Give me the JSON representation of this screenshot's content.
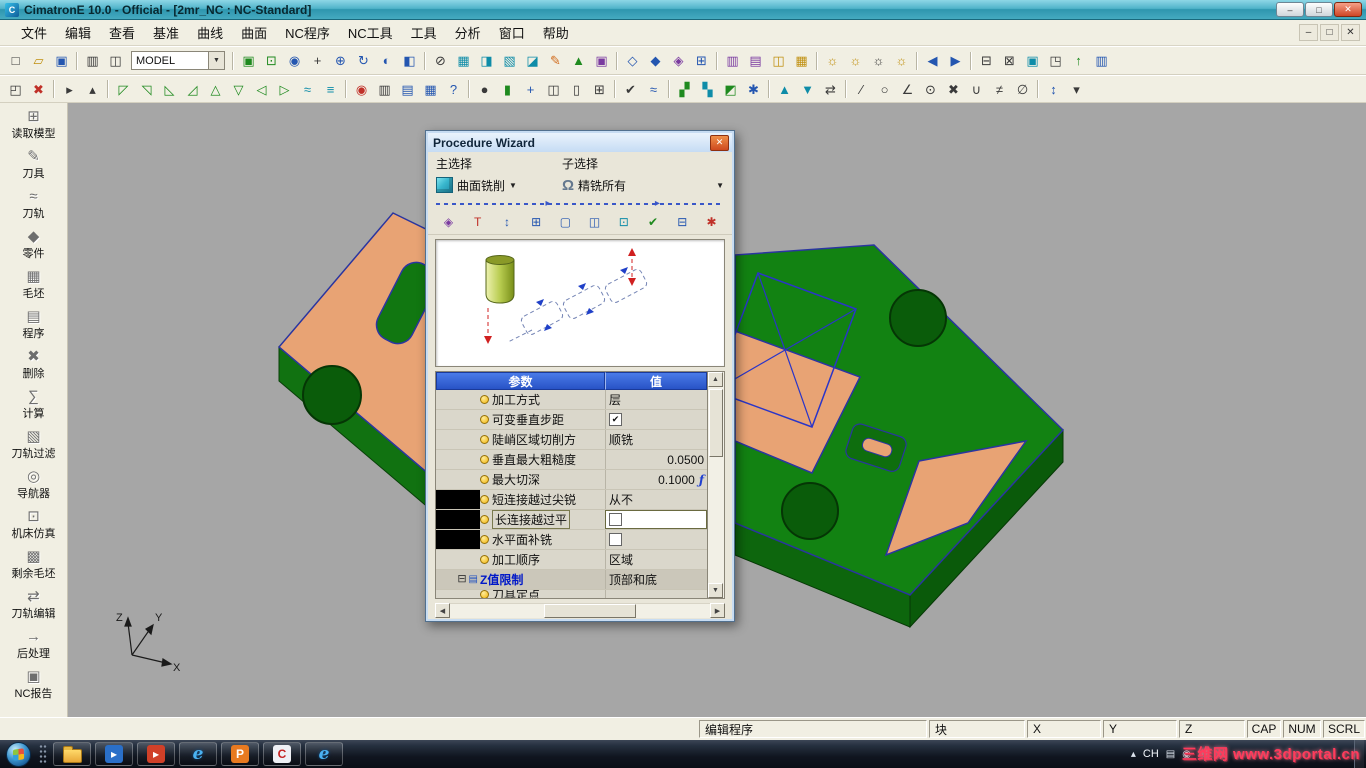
{
  "window": {
    "title": "CimatronE 10.0 - Official - [2mr_NC : NC-Standard]",
    "controls": {
      "minimize": "–",
      "restore": "□",
      "close": "✕"
    }
  },
  "menu": {
    "items": [
      "文件",
      "编辑",
      "查看",
      "基准",
      "曲线",
      "曲面",
      "NC程序",
      "NC工具",
      "工具",
      "分析",
      "窗口",
      "帮助"
    ],
    "mdi": {
      "minimize": "–",
      "restore": "□",
      "close": "✕"
    }
  },
  "toolbars": {
    "model_combo": {
      "value": "MODEL",
      "arrow": "▼"
    },
    "r1a": [
      {
        "g": "□",
        "c": "k",
        "n": "new-file-icon"
      },
      {
        "g": "▱",
        "c": "y",
        "n": "open-file-icon"
      },
      {
        "g": "▣",
        "c": "b",
        "n": "save-icon"
      },
      "|",
      {
        "g": "▥",
        "c": "k",
        "n": "print-icon"
      },
      {
        "g": "◫",
        "c": "k",
        "n": "copy-icon"
      }
    ],
    "r1b": [
      "|",
      {
        "g": "▣",
        "c": "g",
        "n": "select-box-icon"
      },
      {
        "g": "⊡",
        "c": "g",
        "n": "zoom-window-icon"
      },
      {
        "g": "◉",
        "c": "b",
        "n": "zoom-icon"
      },
      {
        "g": "+",
        "c": "k",
        "n": "pan-icon"
      },
      {
        "g": "⊕",
        "c": "b",
        "n": "zoom-all-icon"
      },
      {
        "g": "↻",
        "c": "b",
        "n": "rotate-view-icon"
      },
      {
        "g": "◐",
        "c": "b",
        "n": "shading-icon"
      },
      {
        "g": "◧",
        "c": "b",
        "n": "view-mode-icon"
      },
      "|",
      {
        "g": "⊘",
        "c": "k",
        "n": "clip-plane-icon"
      },
      {
        "g": "▦",
        "c": "c",
        "n": "wireframe-icon"
      },
      {
        "g": "◨",
        "c": "c",
        "n": "render-icon"
      },
      {
        "g": "▧",
        "c": "c",
        "n": "section-icon"
      },
      {
        "g": "◪",
        "c": "c",
        "n": "mesh-icon"
      },
      {
        "g": "✎",
        "c": "o",
        "n": "annotate-icon"
      },
      {
        "g": "▲",
        "c": "g",
        "n": "surface-icon"
      },
      {
        "g": "▣",
        "c": "p",
        "n": "solid-icon"
      },
      "|",
      {
        "g": "◇",
        "c": "b",
        "n": "point-icon"
      },
      {
        "g": "◆",
        "c": "b",
        "n": "curve-icon"
      },
      {
        "g": "◈",
        "c": "p",
        "n": "face-icon"
      },
      {
        "g": "⊞",
        "c": "b",
        "n": "grid-icon"
      },
      "|",
      {
        "g": "▥",
        "c": "p",
        "n": "program-manager-icon"
      },
      {
        "g": "▤",
        "c": "p",
        "n": "report-icon"
      },
      {
        "g": "◫",
        "c": "y",
        "n": "sheet-icon"
      },
      {
        "g": "▦",
        "c": "y",
        "n": "template-icon"
      },
      "|",
      {
        "g": "☼",
        "c": "y",
        "n": "light-icon"
      },
      {
        "g": "☼",
        "c": "y",
        "n": "light2-icon"
      },
      {
        "g": "☼",
        "c": "k",
        "n": "light-off-icon"
      },
      {
        "g": "☼",
        "c": "y",
        "n": "light3-icon"
      },
      "|",
      {
        "g": "◀",
        "c": "b",
        "n": "previous-icon"
      },
      {
        "g": "▶",
        "c": "b",
        "n": "next-icon"
      },
      "|",
      {
        "g": "⊟",
        "c": "k",
        "n": "minimize-view-icon"
      },
      {
        "g": "⊠",
        "c": "k",
        "n": "close-view-icon"
      },
      {
        "g": "▣",
        "c": "c",
        "n": "arrange-icon"
      },
      {
        "g": "◳",
        "c": "k",
        "n": "new-window-icon"
      },
      {
        "g": "↑",
        "c": "g",
        "n": "up-icon"
      },
      {
        "g": "▥",
        "c": "b",
        "n": "properties-icon"
      }
    ],
    "r2": [
      {
        "g": "◰",
        "c": "k",
        "n": "selection-filter-icon"
      },
      {
        "g": "✖",
        "c": "r",
        "n": "clear-selection-icon"
      },
      "|",
      {
        "g": "▸",
        "c": "k",
        "n": "pick-icon"
      },
      {
        "g": "▴",
        "c": "k",
        "n": "pick-chain-icon"
      },
      "|",
      {
        "g": "◸",
        "c": "g"
      },
      {
        "g": "◹",
        "c": "g"
      },
      {
        "g": "◺",
        "c": "g"
      },
      {
        "g": "◿",
        "c": "g"
      },
      {
        "g": "△",
        "c": "g"
      },
      {
        "g": "▽",
        "c": "g"
      },
      {
        "g": "◁",
        "c": "g"
      },
      {
        "g": "▷",
        "c": "g"
      },
      {
        "g": "≈",
        "c": "c"
      },
      {
        "g": "≡",
        "c": "c"
      },
      "|",
      {
        "g": "◉",
        "c": "r",
        "n": "record-icon"
      },
      {
        "g": "▥",
        "c": "k"
      },
      {
        "g": "▤",
        "c": "b"
      },
      {
        "g": "▦",
        "c": "b"
      },
      {
        "g": "?",
        "c": "b",
        "n": "help-icon"
      },
      "|",
      {
        "g": "●",
        "c": "k"
      },
      {
        "g": "▮",
        "c": "g"
      },
      {
        "g": "+",
        "c": "b"
      },
      {
        "g": "◫",
        "c": "k"
      },
      {
        "g": "▯",
        "c": "k"
      },
      {
        "g": "⊞",
        "c": "k"
      },
      "|",
      {
        "g": "✔",
        "c": "k",
        "n": "validate-icon"
      },
      {
        "g": "≈",
        "c": "b"
      },
      "|",
      {
        "g": "▞",
        "c": "g"
      },
      {
        "g": "▚",
        "c": "c"
      },
      {
        "g": "◩",
        "c": "g"
      },
      {
        "g": "✱",
        "c": "b"
      },
      "|",
      {
        "g": "▲",
        "c": "c"
      },
      {
        "g": "▼",
        "c": "c"
      },
      {
        "g": "⇄",
        "c": "k"
      },
      "|",
      {
        "g": "∕",
        "c": "k",
        "n": "line-icon"
      },
      {
        "g": "○",
        "c": "k",
        "n": "circle-icon"
      },
      {
        "g": "∠",
        "c": "k",
        "n": "angle-icon"
      },
      {
        "g": "⊙",
        "c": "k"
      },
      {
        "g": "✖",
        "c": "k"
      },
      {
        "g": "∪",
        "c": "k"
      },
      {
        "g": "≠",
        "c": "k"
      },
      {
        "g": "∅",
        "c": "k"
      },
      "|",
      {
        "g": "↕",
        "c": "b",
        "n": "measure-icon"
      },
      {
        "g": "▾",
        "c": "k"
      }
    ]
  },
  "sidebar": {
    "items": [
      {
        "label": "读取模型",
        "icon": "read-model-icon",
        "glyph": "⊞"
      },
      {
        "label": "刀具",
        "icon": "tool-icon",
        "glyph": "✎"
      },
      {
        "label": "刀轨",
        "icon": "toolpath-icon",
        "glyph": "≈"
      },
      {
        "label": "零件",
        "icon": "part-icon",
        "glyph": "◆"
      },
      {
        "label": "毛坯",
        "icon": "stock-icon",
        "glyph": "▦"
      },
      {
        "label": "程序",
        "icon": "program-icon",
        "glyph": "▤"
      },
      {
        "label": "删除",
        "icon": "delete-icon",
        "glyph": "✖"
      },
      {
        "label": "计算",
        "icon": "calculate-icon",
        "glyph": "∑"
      },
      {
        "label": "刀轨过滤",
        "icon": "toolpath-filter-icon",
        "glyph": "▧"
      },
      {
        "label": "导航器",
        "icon": "navigator-icon",
        "glyph": "◎"
      },
      {
        "label": "机床仿真",
        "icon": "machine-sim-icon",
        "glyph": "⊡"
      },
      {
        "label": "剩余毛坯",
        "icon": "remaining-stock-icon",
        "glyph": "▩"
      },
      {
        "label": "刀轨编辑",
        "icon": "toolpath-edit-icon",
        "glyph": "⇄"
      },
      {
        "label": "后处理",
        "icon": "post-process-icon",
        "glyph": "→"
      },
      {
        "label": "NC报告",
        "icon": "nc-report-icon",
        "glyph": "▣"
      }
    ]
  },
  "viewport": {
    "axes": {
      "x": "X",
      "y": "Y",
      "z": "Z"
    }
  },
  "dialog": {
    "title": "Procedure Wizard",
    "close_glyph": "✕",
    "dropdown_glyph": "▼",
    "main_label": "主选择",
    "sub_label": "子选择",
    "main_value": "曲面铣削",
    "sub_value": "精铣所有",
    "toolbar": [
      {
        "g": "◈",
        "c": "p",
        "n": "geometry-icon"
      },
      {
        "g": "T",
        "c": "r",
        "n": "tool-icon"
      },
      {
        "g": "↕",
        "c": "b",
        "n": "z-levels-icon"
      },
      {
        "g": "⊞",
        "c": "b",
        "n": "parameters-icon"
      },
      {
        "g": "▢",
        "c": "b",
        "n": "preview-icon"
      },
      {
        "g": "◫",
        "c": "b",
        "n": "display-icon"
      },
      {
        "g": "⊡",
        "c": "c",
        "n": "simulate-icon"
      },
      {
        "g": "✔",
        "c": "g",
        "n": "verify-icon"
      },
      {
        "g": "⊟",
        "c": "b",
        "n": "save-procedure-icon"
      },
      {
        "g": "✱",
        "c": "r",
        "n": "execute-icon"
      }
    ],
    "table": {
      "param_header": "参数",
      "value_header": "值",
      "check_glyph": "✔",
      "formula_glyph": "ƒ",
      "rows": [
        {
          "param": "加工方式",
          "value": "层",
          "type": "text"
        },
        {
          "param": "可变垂直步距",
          "type": "checkbox",
          "checked": true
        },
        {
          "param": "陡峭区域切削方",
          "value": "顺铣",
          "type": "text"
        },
        {
          "param": "垂直最大粗糙度",
          "value": "0.0500",
          "type": "number"
        },
        {
          "param": "最大切深",
          "value": "0.1000",
          "type": "number",
          "formula": true
        },
        {
          "param": "短连接越过尖锐",
          "value": "从不",
          "type": "text",
          "black": true
        },
        {
          "param": "长连接越过平",
          "type": "checkbox",
          "checked": false,
          "black": true,
          "selected": true
        },
        {
          "param": "水平面补铣",
          "type": "checkbox",
          "checked": false,
          "black": true
        },
        {
          "param": "加工顺序",
          "value": "区域",
          "type": "text"
        },
        {
          "param": "Z值限制",
          "value": "顶部和底",
          "type": "group"
        },
        {
          "param": "刀具定点",
          "value": "",
          "type": "text",
          "clipped": true
        }
      ]
    }
  },
  "statusbar": {
    "program": "编辑程序",
    "block": "块",
    "x_label": "X",
    "y_label": "Y",
    "z_label": "Z",
    "cap": "CAP",
    "num": "NUM",
    "scrl": "SCRL"
  },
  "taskbar": {
    "apps": [
      {
        "n": "explorer-icon",
        "folder": true
      },
      {
        "n": "media-player-icon",
        "g": "▸",
        "bg": "#2A6FC8",
        "fg": "#FFFFFF"
      },
      {
        "n": "video-app-icon",
        "g": "▸",
        "bg": "#D04028",
        "fg": "#FFFFFF"
      },
      {
        "n": "ie-icon",
        "g": "e",
        "ie": true,
        "fg": "#4AB2F2"
      },
      {
        "n": "p-app-icon",
        "g": "P",
        "bg": "#E87A20",
        "fg": "#FFFFFF"
      },
      {
        "n": "cimatron-icon",
        "g": "C",
        "bg": "#EEF0F5",
        "fg": "#C42222"
      },
      {
        "n": "browser-icon",
        "g": "e",
        "ie": true,
        "fg": "#4AB2F2"
      }
    ],
    "tray": [
      {
        "g": "▴",
        "n": "show-hidden-icon"
      },
      {
        "t": "CH",
        "n": "language-indicator"
      },
      {
        "g": "▤",
        "n": "keyboard-icon"
      },
      {
        "g": "◉",
        "n": "tray-status-icon"
      },
      {
        "g": "●",
        "n": "network-icon"
      }
    ],
    "watermark": "三维网 www.3dportal.cn"
  }
}
